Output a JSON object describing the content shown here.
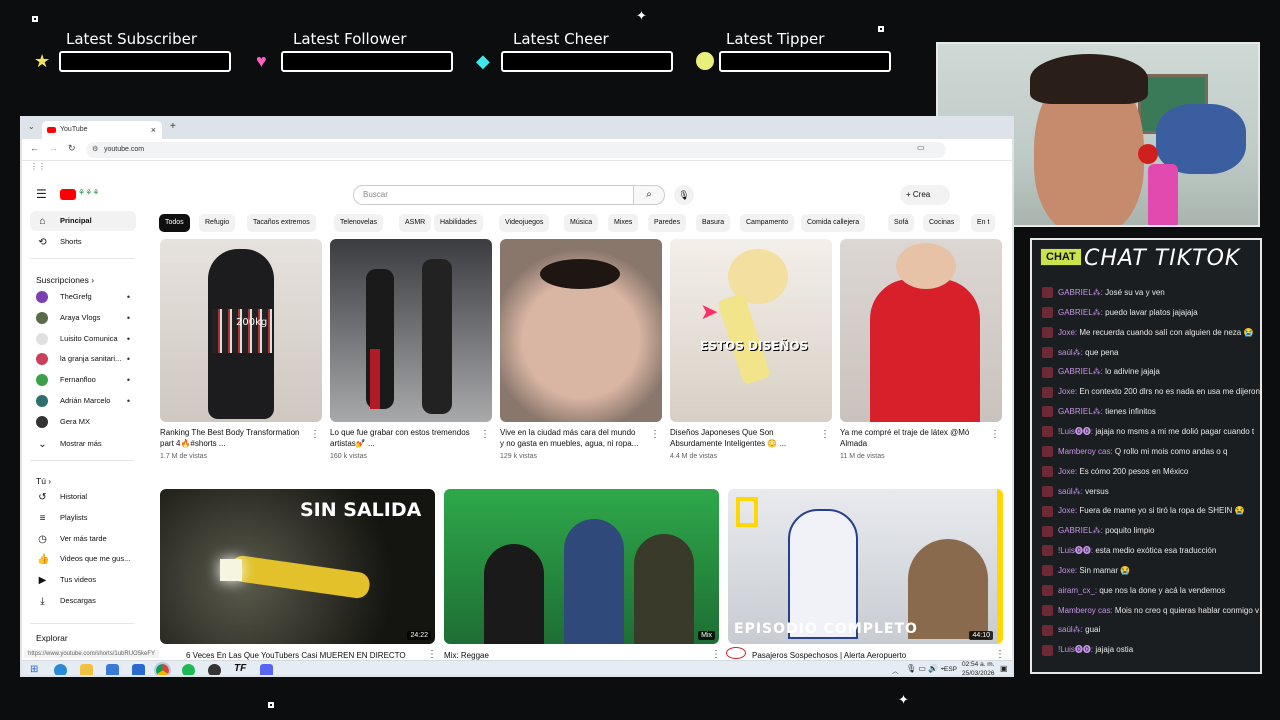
{
  "overlay": {
    "alerts": [
      {
        "label": "Latest Subscriber",
        "icon": "star-icon",
        "color": "#f3e45b"
      },
      {
        "label": "Latest Follower",
        "icon": "heart-icon",
        "color": "#ff5fbf"
      },
      {
        "label": "Latest Cheer",
        "icon": "gem-icon",
        "color": "#3fe6ea"
      },
      {
        "label": "Latest Tipper",
        "icon": "coin-icon",
        "color": "#e8ef7a"
      }
    ]
  },
  "chat": {
    "badge": "CHAT",
    "title": "CHAT TIKTOK",
    "messages": [
      {
        "user": "GABRIEL⁂:",
        "text": "José su va y ven"
      },
      {
        "user": "GABRIEL⁂:",
        "text": "puedo lavar platos jajajaja"
      },
      {
        "user": "Joxe:",
        "text": "Me recuerda cuando salí con alguien de neza 😭"
      },
      {
        "user": "saúl⁂:",
        "text": "que pena"
      },
      {
        "user": "GABRIEL⁂:",
        "text": "lo adivine jajaja"
      },
      {
        "user": "Joxe:",
        "text": "En contexto 200 dlrs no es nada en usa me dijeron"
      },
      {
        "user": "GABRIEL⁂:",
        "text": "tienes infinitos"
      },
      {
        "user": "!Luis⓿⓿:",
        "text": "jajaja no msms a mi me dolió pagar cuando t"
      },
      {
        "user": "Mamberoy cas:",
        "text": "Q rollo mi mois como andas o q"
      },
      {
        "user": "Joxe:",
        "text": "Es cómo 200 pesos en México"
      },
      {
        "user": "saúl⁂:",
        "text": "versus"
      },
      {
        "user": "Joxe:",
        "text": "Fuera de mame yo si tiró la ropa de SHEIN 😭"
      },
      {
        "user": "GABRIEL⁂:",
        "text": "poquito limpio"
      },
      {
        "user": "!Luis⓿⓿:",
        "text": "esta medio exótica esa traducción"
      },
      {
        "user": "Joxe:",
        "text": "Sin mamar 😭"
      },
      {
        "user": "airam_cx_:",
        "text": "que nos la done y acá la vendemos"
      },
      {
        "user": "Mamberoy cas:",
        "text": "Mois no creo q quieras hablar conmigo v"
      },
      {
        "user": "saúl⁂:",
        "text": "guai"
      },
      {
        "user": "!Luis⓿⓿:",
        "text": "jajaja ostia"
      }
    ]
  },
  "browser": {
    "tab_title": "YouTube",
    "url": "youtube.com",
    "status_url": "https://www.youtube.com/shorts/1ubRUO5keFY"
  },
  "youtube": {
    "search_placeholder": "Buscar",
    "create_label": "Crea",
    "sidebar": {
      "main": [
        {
          "label": "Principal",
          "icon": "home-icon",
          "active": true
        },
        {
          "label": "Shorts",
          "icon": "shorts-icon"
        }
      ],
      "subs_heading": "Suscripciones",
      "subs": [
        {
          "label": "TheGrefg",
          "color": "#7a3fb0"
        },
        {
          "label": "Araya Vlogs",
          "color": "#5a6b4a"
        },
        {
          "label": "Luisito Comunica",
          "color": "#e0e0e0"
        },
        {
          "label": "la granja sanitari...",
          "color": "#c8405a"
        },
        {
          "label": "Fernanfloo",
          "color": "#3ca04a"
        },
        {
          "label": "Adrián Marcelo",
          "color": "#2f6e6e"
        },
        {
          "label": "Gera MX",
          "color": "#333333"
        }
      ],
      "more_label": "Mostrar más",
      "you_heading": "Tú",
      "you": [
        {
          "label": "Historial",
          "icon": "history-icon"
        },
        {
          "label": "Playlists",
          "icon": "playlist-icon"
        },
        {
          "label": "Ver más tarde",
          "icon": "clock-icon"
        },
        {
          "label": "Videos que me gus...",
          "icon": "like-icon"
        },
        {
          "label": "Tus videos",
          "icon": "video-icon"
        },
        {
          "label": "Descargas",
          "icon": "download-icon"
        }
      ],
      "explore_heading": "Explorar"
    },
    "chips": [
      "Todos",
      "Refugio",
      "Tacaños extremos",
      "Telenovelas",
      "ASMR",
      "Habilidades",
      "Videojuegos",
      "Música",
      "Mixes",
      "Paredes",
      "Basura",
      "Campamento",
      "Comida callejera",
      "Sofá",
      "Cocinas",
      "En t"
    ],
    "shorts": [
      {
        "title": "Ranking The Best Body Transformation part 4🔥#shorts ...",
        "views": "1.7 M de vistas",
        "overlay": "200kg"
      },
      {
        "title": "Lo que fue grabar con estos tremendos artistas💅 ...",
        "views": "160 k vistas",
        "overlay": ""
      },
      {
        "title": "Vive en la ciudad más cara del mundo y no gasta en muebles, agua, ni ropa...",
        "views": "129 k vistas",
        "overlay": ""
      },
      {
        "title": "Diseños Japoneses Que Son Absurdamente Inteligentes 😳 ...",
        "views": "4.4 M de vistas",
        "overlay": "ESTOS DISEÑOS"
      },
      {
        "title": "Ya me compré el traje de látex @Mó Almada",
        "views": "11 M de vistas",
        "overlay": ""
      }
    ],
    "videos": [
      {
        "title": "6 Veces En Las Que YouTubers Casi MUEREN EN DIRECTO",
        "duration": "24:22",
        "overlay": "SIN SALIDA"
      },
      {
        "title": "Mix: Reggae",
        "duration": "Mix",
        "overlay": ""
      },
      {
        "title": "Pasajeros Sospechosos | Alerta Aeropuerto",
        "duration": "44:10",
        "overlay": "EPISODIO COMPLETO"
      }
    ]
  },
  "taskbar": {
    "lang": "ESP",
    "time": "02:54 a. m.",
    "date": "25/03/2026"
  }
}
